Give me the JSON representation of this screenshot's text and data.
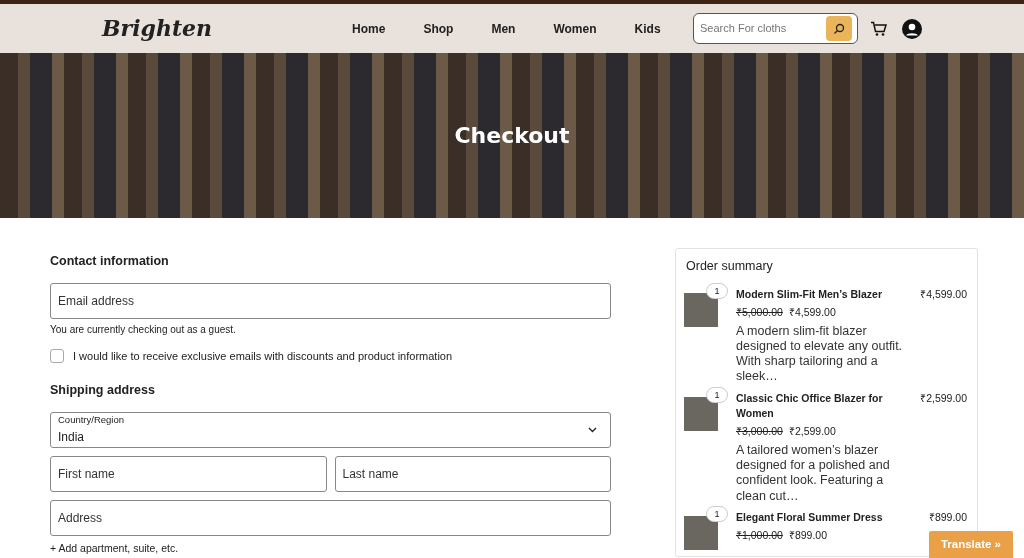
{
  "navbar": {
    "logo": "Brighten",
    "links": [
      "Home",
      "Shop",
      "Men",
      "Women",
      "Kids"
    ],
    "search": {
      "placeholder": "Search For cloths"
    }
  },
  "hero": {
    "title": "Checkout"
  },
  "contact": {
    "heading": "Contact information",
    "email": {
      "placeholder": "Email address"
    },
    "guest_note": "You are currently checking out as a guest.",
    "newsletter": {
      "label": "I would like to receive exclusive emails with discounts and product information",
      "checked": false
    }
  },
  "shipping": {
    "heading": "Shipping address",
    "country": {
      "label": "Country/Region",
      "value": "India"
    },
    "first_name": {
      "placeholder": "First name"
    },
    "last_name": {
      "placeholder": "Last name"
    },
    "address": {
      "placeholder": "Address"
    },
    "add_line": "+ Add apartment, suite, etc."
  },
  "order_summary": {
    "heading": "Order summary",
    "items": [
      {
        "quantity": "1",
        "name": "Modern Slim-Fit Men’s Blazer",
        "old_price": "₹5,000.00",
        "price": "₹4,599.00",
        "description": "A modern slim-fit blazer designed to elevate any outfit. With sharp tailoring and a sleek…",
        "total": "₹4,599.00"
      },
      {
        "quantity": "1",
        "name": "Classic Chic Office Blazer for Women",
        "old_price": "₹3,000.00",
        "price": "₹2,599.00",
        "description": "A tailored women’s blazer designed for a polished and confident look. Featuring a clean cut…",
        "total": "₹2,599.00"
      },
      {
        "quantity": "1",
        "name": "Elegant Floral Summer Dress",
        "old_price": "₹1,000.00",
        "price": "₹899.00",
        "total": "₹899.00"
      }
    ]
  },
  "translate_button": "Translate »"
}
